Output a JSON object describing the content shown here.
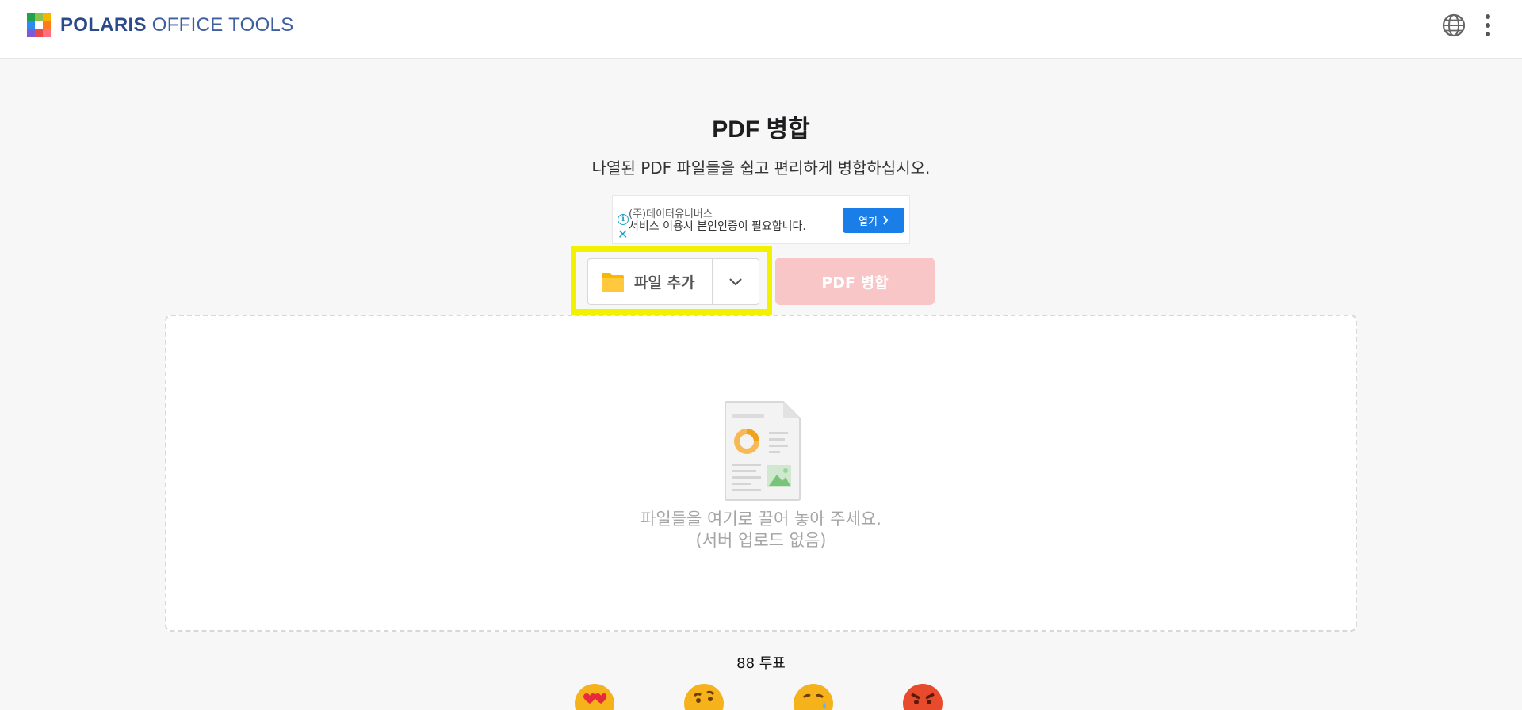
{
  "header": {
    "logo_brand": "POLARIS",
    "logo_rest": "OFFICE TOOLS",
    "logo_colors": [
      "#1fa34a",
      "#f4b400",
      "#ff7a1a",
      "#2d8cf0",
      "#ffffff",
      "#e94b4b",
      "#7b5cd6",
      "#c3c3ff",
      "#ff6f80"
    ],
    "icons": [
      "globe-icon",
      "more-vertical-icon"
    ]
  },
  "page": {
    "title": "PDF 병합",
    "subtitle": "나열된 PDF 파일들을 쉽고 편리하게 병합하십시오."
  },
  "ad": {
    "company": "(주)데이터유니버스",
    "text": "서비스 이용시 본인인증이 필요합니다.",
    "button_label": "열기",
    "info_glyph": "i",
    "close_glyph": "✕",
    "accent_color": "#1a7ee8"
  },
  "toolbar": {
    "add_file_label": "파일 추가",
    "merge_label": "PDF 병합",
    "merge_color": "#f9c6c8",
    "highlight_color": "#f2f200"
  },
  "dropzone": {
    "line1": "파일들을 여기로 끌어 놓아 주세요.",
    "line2": "(서버 업로드 없음)"
  },
  "feedback": {
    "votes_label": "88 투표",
    "emojis": [
      "heart-eyes-emoji",
      "thinking-emoji",
      "sweat-emoji",
      "angry-emoji"
    ]
  }
}
